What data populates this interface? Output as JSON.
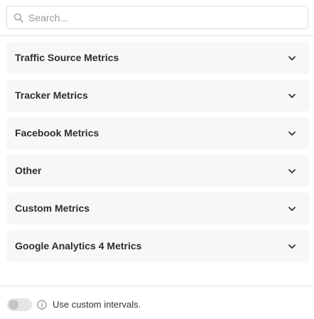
{
  "search": {
    "placeholder": "Search...",
    "value": "",
    "icon": "search-icon"
  },
  "sections": [
    {
      "label": "Traffic Source Metrics",
      "icon": "chevron-down-icon"
    },
    {
      "label": "Tracker Metrics",
      "icon": "chevron-down-icon"
    },
    {
      "label": "Facebook Metrics",
      "icon": "chevron-down-icon"
    },
    {
      "label": "Other",
      "icon": "chevron-down-icon"
    },
    {
      "label": "Custom Metrics",
      "icon": "chevron-down-icon"
    },
    {
      "label": "Google Analytics 4 Metrics",
      "icon": "chevron-down-icon"
    }
  ],
  "footer": {
    "toggle_on": false,
    "info_icon": "info-icon",
    "label": "Use custom intervals."
  },
  "colors": {
    "section_bg": "#f7f7f7",
    "toggle_off": "#e6e6e6"
  }
}
